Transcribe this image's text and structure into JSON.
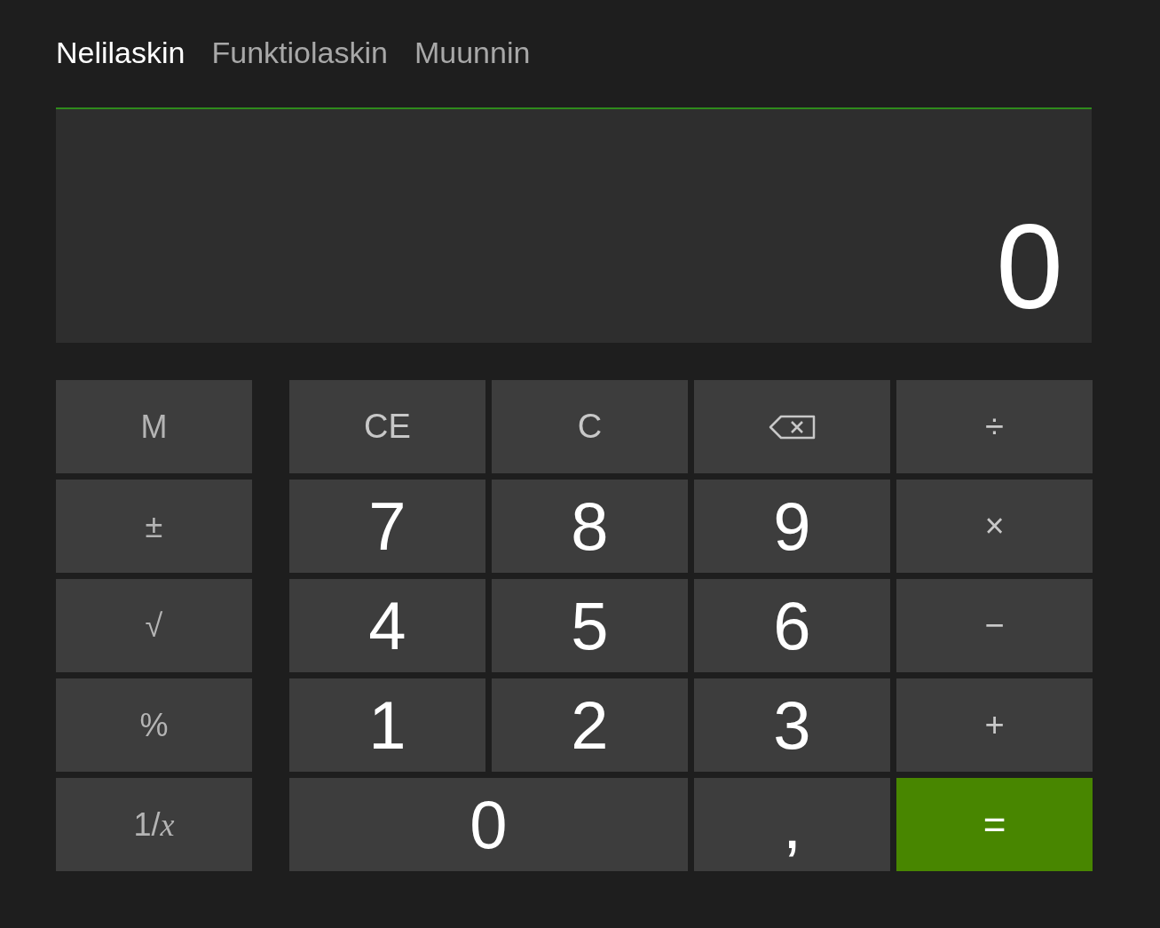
{
  "tabs": [
    {
      "label": "Nelilaskin",
      "selected": true
    },
    {
      "label": "Funktiolaskin",
      "selected": false
    },
    {
      "label": "Muunnin",
      "selected": false
    }
  ],
  "display": {
    "value": "0"
  },
  "memory_keys": [
    {
      "label": "M"
    },
    {
      "label": "±"
    },
    {
      "label": "√"
    },
    {
      "label": "%"
    },
    {
      "label": "1/*x*"
    }
  ],
  "keys": [
    {
      "kind": "operator",
      "label": "CE",
      "wide": false
    },
    {
      "kind": "operator",
      "label": "C",
      "wide": false
    },
    {
      "kind": "backspace",
      "wide": false
    },
    {
      "kind": "operator",
      "label": "÷",
      "wide": false
    },
    {
      "kind": "digit",
      "label": "7",
      "wide": false
    },
    {
      "kind": "digit",
      "label": "8",
      "wide": false
    },
    {
      "kind": "digit",
      "label": "9",
      "wide": false
    },
    {
      "kind": "operator",
      "label": "×",
      "wide": false
    },
    {
      "kind": "digit",
      "label": "4",
      "wide": false
    },
    {
      "kind": "digit",
      "label": "5",
      "wide": false
    },
    {
      "kind": "digit",
      "label": "6",
      "wide": false
    },
    {
      "kind": "operator",
      "label": "−",
      "wide": false
    },
    {
      "kind": "digit",
      "label": "1",
      "wide": false
    },
    {
      "kind": "digit",
      "label": "2",
      "wide": false
    },
    {
      "kind": "digit",
      "label": "3",
      "wide": false
    },
    {
      "kind": "operator",
      "label": "+",
      "wide": false
    },
    {
      "kind": "digit",
      "label": "0",
      "wide": true
    },
    {
      "kind": "digit",
      "label": ",",
      "wide": false
    },
    {
      "kind": "equals",
      "label": "=",
      "wide": false
    }
  ]
}
